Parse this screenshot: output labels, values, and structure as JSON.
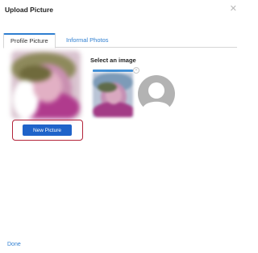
{
  "dialog": {
    "title": "Upload Picture",
    "close_icon": "close-icon"
  },
  "tabs": [
    {
      "label": "Profile Picture",
      "active": true
    },
    {
      "label": "Informal Photos",
      "active": false
    }
  ],
  "profile": {
    "new_picture_label": "New Picture",
    "select_image_label": "Select an image",
    "placeholder_icon": "default-user-avatar-icon"
  },
  "footer": {
    "done_label": "Done"
  },
  "colors": {
    "accent": "#2f7fd1",
    "button": "#1f63c9",
    "highlight_border": "#b3243a"
  }
}
